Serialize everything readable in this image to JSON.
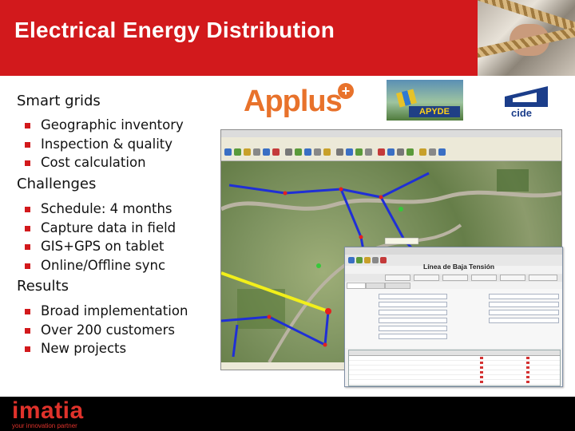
{
  "header": {
    "title": "Electrical Energy Distribution"
  },
  "sections": [
    {
      "heading": "Smart grids",
      "items": [
        "Geographic inventory",
        "Inspection & quality",
        "Cost calculation"
      ]
    },
    {
      "heading": "Challenges",
      "items": [
        "Schedule: 4 months",
        "Capture data in field",
        "GIS+GPS on tablet",
        "Online/Offline sync"
      ]
    },
    {
      "heading": "Results",
      "items": [
        "Broad implementation",
        "Over 200 customers",
        "New projects"
      ]
    }
  ],
  "logos": {
    "applus": "Applus",
    "apyde": "APYDE",
    "cide": "cide"
  },
  "dialog": {
    "heading": "Línea de Baja Tensión"
  },
  "footer": {
    "brand": "imatia",
    "tagline": "your innovation partner"
  },
  "colors": {
    "brand_red": "#d2191c",
    "map_line_blue": "#1f2fd6",
    "map_line_yellow": "#f2ef1a",
    "map_node_red": "#e41f1f"
  }
}
